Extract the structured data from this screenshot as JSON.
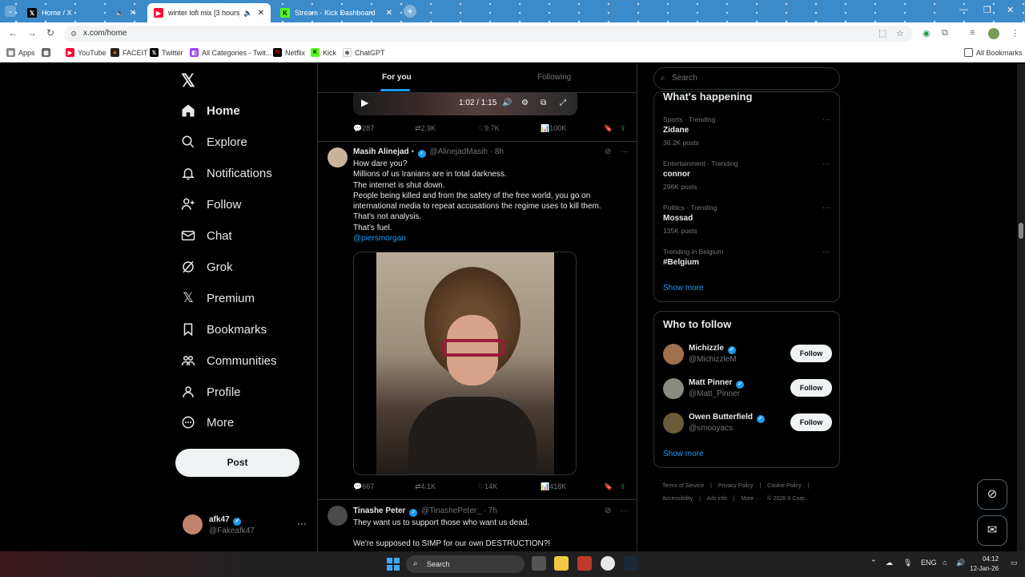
{
  "browser": {
    "tabs": [
      {
        "title": "Home / X",
        "active": false
      },
      {
        "title": "winter lofi mix [3 hours] ❄️",
        "active": true
      },
      {
        "title": "Stream - Kick Dashboard",
        "active": false
      }
    ],
    "url": "x.com/home",
    "bookmarks": [
      "Apps",
      "YouTube",
      "FACEIT",
      "Twitter",
      "All Categories - Twit...",
      "Netflix",
      "Kick",
      "ChatGPT"
    ],
    "all_bookmarks": "All Bookmarks"
  },
  "nav": {
    "items": [
      "Home",
      "Explore",
      "Notifications",
      "Follow",
      "Chat",
      "Grok",
      "Premium",
      "Bookmarks",
      "Communities",
      "Profile",
      "More"
    ],
    "post_label": "Post",
    "account": {
      "name": "afk47",
      "handle": "@Fakeafk47"
    }
  },
  "feed": {
    "tabs": [
      "For you",
      "Following"
    ],
    "video": {
      "time": "1:02 / 1:15"
    },
    "prev_actions": {
      "replies": "287",
      "reposts": "2.9K",
      "likes": "9.7K",
      "views": "100K"
    },
    "tweet1": {
      "name": "Masih Alinejad",
      "handle": "@AlinejadMasih",
      "time": "· 8h",
      "lines": [
        "How dare you?",
        "Millions of us Iranians are in total darkness.",
        "The internet is shut down.",
        "People being killed and from the safety of the free world, you go on",
        "international media to repeat accusations the regime uses to kill them.",
        "That's not analysis.",
        "That's fuel."
      ],
      "mention": "@piersmorgan",
      "actions": {
        "replies": "667",
        "reposts": "4.1K",
        "likes": "14K",
        "views": "418K"
      }
    },
    "tweet2": {
      "name": "Tinashe Peter",
      "handle": "@TinashePeter_",
      "time": "· 7h",
      "line1": "They want us to support those who want us dead.",
      "line2": "We're supposed to SIMP for our own DESTRUCTION?!"
    }
  },
  "sidebar": {
    "search_placeholder": "Search",
    "trending_title": "What's happening",
    "trends": [
      {
        "category": "Sports · Trending",
        "name": "Zidane",
        "count": "36.2K posts"
      },
      {
        "category": "Entertainment · Trending",
        "name": "connor",
        "count": "296K posts"
      },
      {
        "category": "Politics · Trending",
        "name": "Mossad",
        "count": "135K posts"
      },
      {
        "category": "Trending in Belgium",
        "name": "#Belgium",
        "count": ""
      }
    ],
    "show_more": "Show more",
    "wtf_title": "Who to follow",
    "wtf": [
      {
        "name": "Michizzle",
        "handle": "@MichizzleM"
      },
      {
        "name": "Matt Pinner",
        "handle": "@Matt_Pinner"
      },
      {
        "name": "Owen Butterfield",
        "handle": "@smooyacs"
      }
    ],
    "follow_label": "Follow",
    "footer": [
      "Terms of Service",
      "|",
      "Privacy Policy",
      "|",
      "Cookie Policy",
      "|",
      "Accessibility",
      "|",
      "Ads info",
      "|",
      "More ···",
      "© 2026 X Corp."
    ]
  },
  "taskbar": {
    "search": "Search",
    "lang": "ENG",
    "time": "04:12",
    "date": "12-Jan-26"
  },
  "colors": {
    "accent": "#1d9bf0",
    "background": "#000000",
    "border": "#2f3336",
    "muted": "#71767b"
  }
}
